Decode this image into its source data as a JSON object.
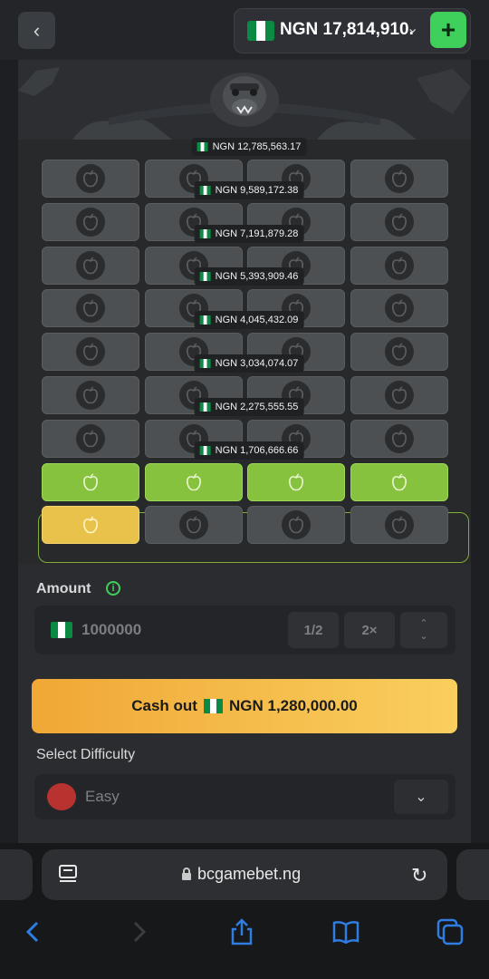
{
  "colors": {
    "accent_green": "#3fcf5b",
    "tile_green": "#86c23d",
    "tile_gold": "#e8c24a",
    "cashout_start": "#f0a736",
    "cashout_end": "#f9cf5e",
    "ios_blue": "#2f7de0"
  },
  "header": {
    "back_icon": "chevron-left-icon",
    "balance": "NGN 17,814,910.",
    "balance_dropdown_icon": "chevron-down-icon",
    "deposit_icon": "plus-icon",
    "currency_flag": "nigeria-flag-icon"
  },
  "game": {
    "multipliers": [
      "NGN 12,785,563.17",
      "NGN 9,589,172.38",
      "NGN 7,191,879.28",
      "NGN 5,393,909.46",
      "NGN 4,045,432.09",
      "NGN 3,034,074.07",
      "NGN 2,275,555.55",
      "NGN 1,706,666.66"
    ],
    "rows": [
      [
        "closed",
        "closed",
        "closed",
        "closed"
      ],
      [
        "closed",
        "closed",
        "closed",
        "closed"
      ],
      [
        "closed",
        "closed",
        "closed",
        "closed"
      ],
      [
        "closed",
        "closed",
        "closed",
        "closed"
      ],
      [
        "closed",
        "closed",
        "closed",
        "closed"
      ],
      [
        "closed",
        "closed",
        "closed",
        "closed"
      ],
      [
        "closed",
        "closed",
        "closed",
        "closed"
      ],
      [
        "green",
        "green",
        "green",
        "green"
      ],
      [
        "gold",
        "closed",
        "closed",
        "closed"
      ]
    ],
    "tile_icon": "apple-icon",
    "mascot_icon": "gorilla-icon"
  },
  "bet": {
    "amount_label": "Amount",
    "info_icon": "info-icon",
    "amount_value": "1000000",
    "half_label": "1/2",
    "double_label": "2×",
    "stepper_icon": "up-down-chevron-icon",
    "cashout_prefix": "Cash out",
    "cashout_amount": "NGN 1,280,000.00",
    "difficulty_label": "Select Difficulty",
    "difficulty_value": "Easy",
    "difficulty_icon": "apple-icon",
    "difficulty_dropdown_icon": "chevron-down-icon"
  },
  "browser": {
    "url": "bcgamebet.ng",
    "reader_icon": "reader-mode-icon",
    "lock_icon": "lock-icon",
    "reload_icon": "reload-icon",
    "nav_icons": [
      "back-arrow-icon",
      "forward-arrow-icon",
      "share-icon",
      "bookmarks-icon",
      "tabs-icon"
    ]
  }
}
